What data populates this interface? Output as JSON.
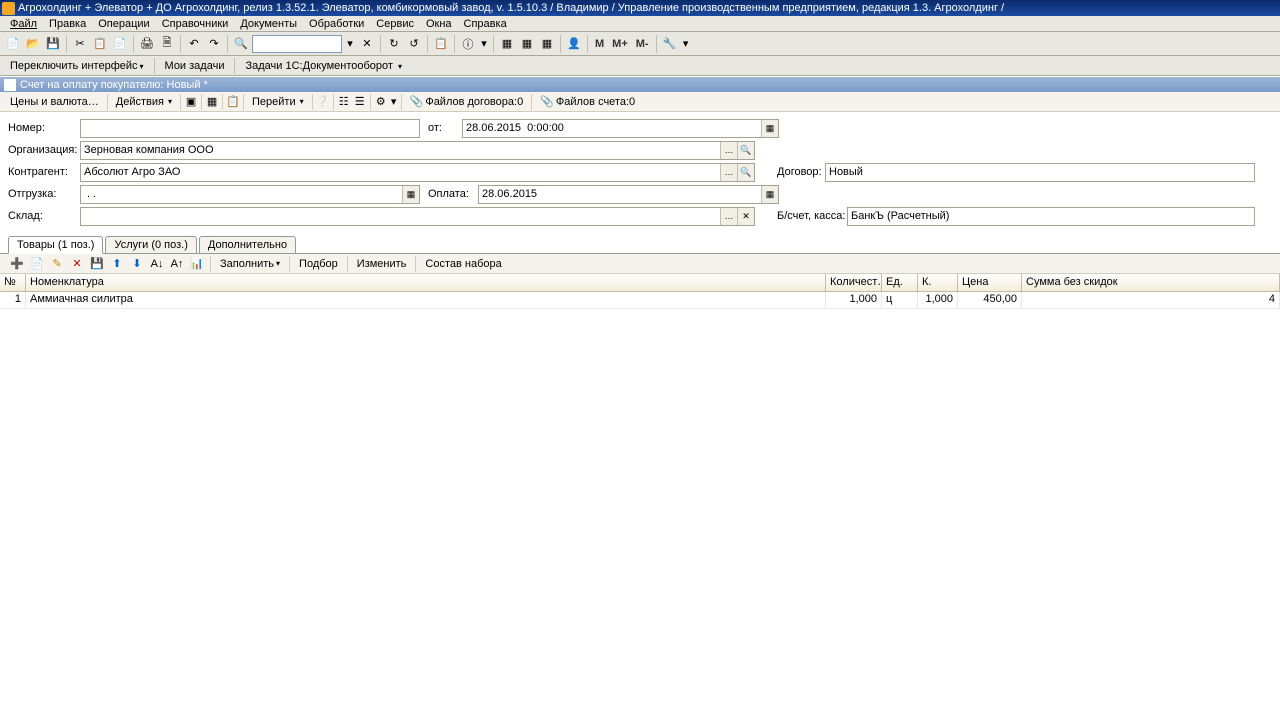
{
  "title": "Агрохолдинг + Элеватор + ДО Агрохолдинг, релиз 1.3.52.1. Элеватор, комбикормовый завод, v.  1.5.10.3 / Владимир /  Управление производственным предприятием, редакция 1.3. Агрохолдинг /",
  "menu": [
    "Файл",
    "Правка",
    "Операции",
    "Справочники",
    "Документы",
    "Обработки",
    "Сервис",
    "Окна",
    "Справка"
  ],
  "mbuttons": [
    "М",
    "М+",
    "М-"
  ],
  "secbar": {
    "switch": "Переключить интерфейс",
    "tasks": "Мои задачи",
    "tasks1c": "Задачи 1С:Документооборот"
  },
  "doc_title": "Счет на оплату покупателю: Новый *",
  "doc_toolbar": {
    "prices": "Цены и валюта…",
    "actions": "Действия",
    "goto": "Перейти",
    "files_contract": "Файлов договора:0",
    "files_invoice": "Файлов счета:0"
  },
  "form": {
    "number_label": "Номер:",
    "from_label": "от:",
    "date_value": "28.06.2015  0:00:00",
    "org_label": "Организация:",
    "org_value": "Зерновая компания ООО",
    "counterparty_label": "Контрагент:",
    "counterparty_value": "Абсолют Агро ЗАО",
    "shipment_label": "Отгрузка:",
    "shipment_value": " . .",
    "payment_label": "Оплата:",
    "payment_value": "28.06.2015",
    "warehouse_label": "Склад:",
    "contract_label": "Договор:",
    "contract_value": "Новый",
    "bank_label": "Б/счет, касса:",
    "bank_value": "БанкЪ (Расчетный)"
  },
  "tabs": [
    "Товары (1 поз.)",
    "Услуги (0 поз.)",
    "Дополнительно"
  ],
  "sub_toolbar": {
    "fill": "Заполнить",
    "select": "Подбор",
    "change": "Изменить",
    "set": "Состав набора"
  },
  "grid": {
    "headers": [
      "№",
      "Номенклатура",
      "Количест…",
      "Ед.",
      "К.",
      "Цена",
      "Сумма без скидок"
    ],
    "row": {
      "n": "1",
      "nomen": "Аммиачная силитра",
      "qty": "1,000",
      "unit": "ц",
      "k": "1,000",
      "price": "450,00",
      "sum": "4"
    }
  }
}
